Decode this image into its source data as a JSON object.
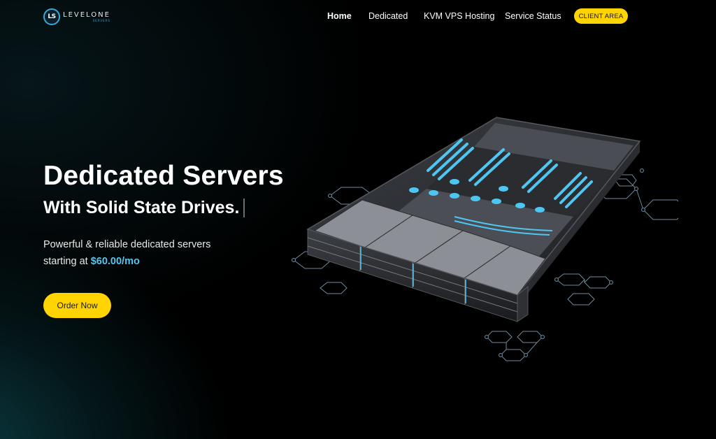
{
  "brand": {
    "mark": "LS",
    "name": "LEVELONE",
    "sub": "SERVERS"
  },
  "nav": {
    "items": [
      "Home",
      "Dedicated",
      "KVM VPS Hosting",
      "Service Status"
    ],
    "client_area": "CLIENT AREA"
  },
  "hero": {
    "title": "Dedicated Servers",
    "subtitle": "With Solid State Drives.",
    "desc_line1": "Powerful & reliable dedicated servers",
    "desc_line2_prefix": "starting at ",
    "price": "$60.00/mo",
    "cta": "Order Now"
  },
  "colors": {
    "accent_yellow": "#ffd400",
    "price_blue": "#55c5f0",
    "background": "#000000",
    "server_blue": "#4ec6f2"
  },
  "icons": {
    "illustration": "server-rack-illustration"
  }
}
